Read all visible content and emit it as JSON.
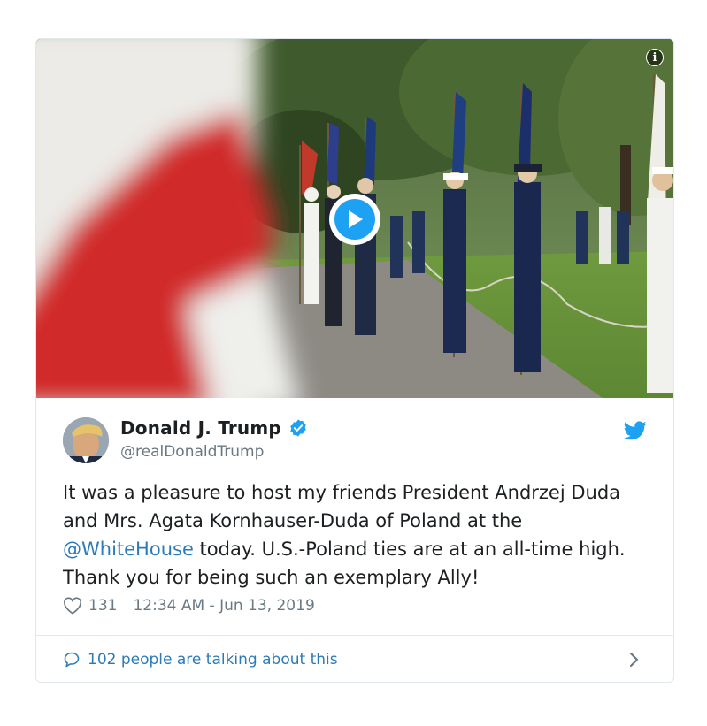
{
  "tweet": {
    "display_name": "Donald J. Trump",
    "handle": "@realDonaldTrump",
    "text_part1": "It was a pleasure to host my friends President Andrzej Duda and Mrs. Agata Kornhauser-Duda of Poland at the ",
    "mention": "@WhiteHouse",
    "text_part2": " today. U.S.-Poland ties are at an all-time high. Thank you for being such an exemplary Ally!",
    "likes": "131",
    "timestamp": "12:34 AM - Jun 13, 2019",
    "conversation_label": "102 people are talking about this"
  },
  "icons": {
    "info": "info-icon",
    "play": "play-icon",
    "verified": "verified-badge-icon",
    "twitter": "twitter-bird-icon",
    "heart": "heart-icon",
    "comment": "comment-icon",
    "chevron": "chevron-right-icon"
  },
  "colors": {
    "accent": "#1da1f2",
    "link": "#2b7bb9",
    "muted": "#697882",
    "text": "#1c2022",
    "border": "#e1e8ed"
  }
}
